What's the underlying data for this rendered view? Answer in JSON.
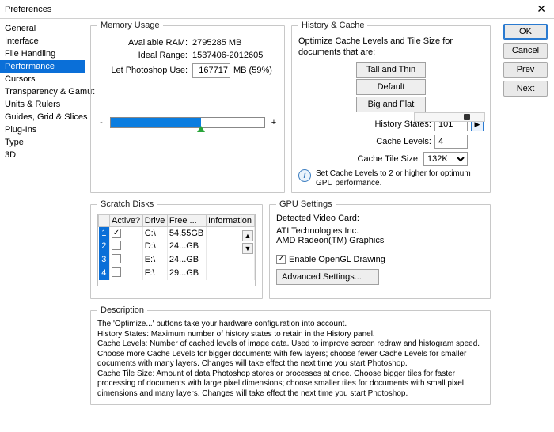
{
  "window": {
    "title": "Preferences"
  },
  "sidebar": {
    "items": [
      {
        "label": "General"
      },
      {
        "label": "Interface"
      },
      {
        "label": "File Handling"
      },
      {
        "label": "Performance"
      },
      {
        "label": "Cursors"
      },
      {
        "label": "Transparency & Gamut"
      },
      {
        "label": "Units & Rulers"
      },
      {
        "label": "Guides, Grid & Slices"
      },
      {
        "label": "Plug-Ins"
      },
      {
        "label": "Type"
      },
      {
        "label": "3D"
      }
    ],
    "selected_index": 3
  },
  "buttons": {
    "ok": "OK",
    "cancel": "Cancel",
    "prev": "Prev",
    "next": "Next"
  },
  "memory": {
    "legend": "Memory Usage",
    "available_label": "Available RAM:",
    "available_value": "2795285 MB",
    "ideal_label": "Ideal Range:",
    "ideal_value": "1537406-2012605",
    "let_label": "Let Photoshop Use:",
    "let_value": "167717",
    "let_unit": "MB (59%)",
    "slider_percent": 59
  },
  "history": {
    "legend": "History & Cache",
    "intro": "Optimize Cache Levels and Tile Size for documents that are:",
    "btn_tall": "Tall and Thin",
    "btn_default": "Default",
    "btn_big": "Big and Flat",
    "states_label": "History States:",
    "states_value": "101",
    "levels_label": "Cache Levels:",
    "levels_value": "4",
    "tile_label": "Cache Tile Size:",
    "tile_value": "132K",
    "info": "Set Cache Levels to 2 or higher for optimum GPU performance."
  },
  "scratch": {
    "legend": "Scratch Disks",
    "cols": {
      "active": "Active?",
      "drive": "Drive",
      "free": "Free ...",
      "info": "Information"
    },
    "rows": [
      {
        "n": "1",
        "active": true,
        "drive": "C:\\",
        "free": "54.55GB",
        "info": ""
      },
      {
        "n": "2",
        "active": false,
        "drive": "D:\\",
        "free": "24...GB",
        "info": ""
      },
      {
        "n": "3",
        "active": false,
        "drive": "E:\\",
        "free": "24...GB",
        "info": ""
      },
      {
        "n": "4",
        "active": false,
        "drive": "F:\\",
        "free": "29...GB",
        "info": ""
      }
    ]
  },
  "gpu": {
    "legend": "GPU Settings",
    "detected_label": "Detected Video Card:",
    "vendor": "ATI Technologies Inc.",
    "card": "AMD Radeon(TM) Graphics",
    "enable_label": "Enable OpenGL Drawing",
    "enable_checked": true,
    "advanced": "Advanced Settings..."
  },
  "description": {
    "legend": "Description",
    "body": "The 'Optimize...' buttons take your hardware configuration into account.\nHistory States: Maximum number of history states to retain in the History panel.\nCache Levels: Number of cached levels of image data.  Used to improve screen redraw and histogram speed.  Choose more Cache Levels for bigger documents with few layers; choose fewer Cache Levels for smaller documents with many layers. Changes will take effect the next time you start Photoshop.\nCache Tile Size: Amount of data Photoshop stores or processes at once. Choose bigger tiles for faster processing of documents with large pixel dimensions; choose smaller tiles for documents with small pixel dimensions and many layers. Changes will take effect the next time you start Photoshop."
  }
}
